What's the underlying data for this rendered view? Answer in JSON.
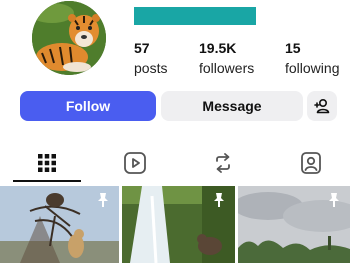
{
  "profile": {
    "avatar_icon": "tiger-profile-photo",
    "name_bar_color": "#19a6a5"
  },
  "stats": [
    {
      "value": "57",
      "label": "posts"
    },
    {
      "value": "19.5K",
      "label": "followers"
    },
    {
      "value": "15",
      "label": "following"
    }
  ],
  "actions": {
    "follow_label": "Follow",
    "message_label": "Message",
    "add_icon": "add-person-icon"
  },
  "tabs": [
    {
      "icon": "grid-icon",
      "active": true
    },
    {
      "icon": "reels-play-icon",
      "active": false
    },
    {
      "icon": "repost-icon",
      "active": false
    },
    {
      "icon": "tagged-icon",
      "active": false
    }
  ],
  "grid": [
    {
      "subject": "birds-and-leopard-in-tree",
      "pinned": true
    },
    {
      "subject": "waterfall-with-monkey",
      "pinned": true
    },
    {
      "subject": "cloudy-sky-over-trees",
      "pinned": true
    }
  ],
  "colors": {
    "accent": "#4a5df0",
    "button_bg": "#efeff1",
    "icon": "#555555"
  }
}
